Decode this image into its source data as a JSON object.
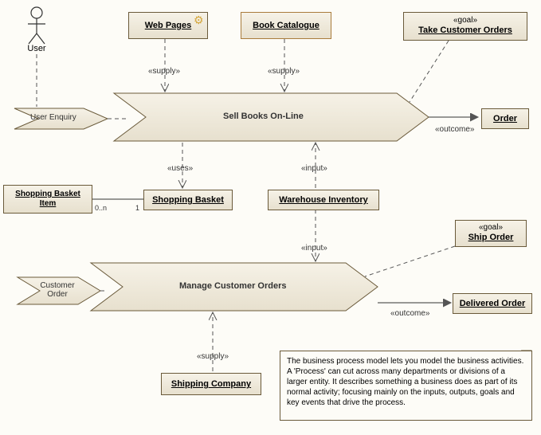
{
  "actor": {
    "label": "User"
  },
  "boxes": {
    "webPages": "Web Pages",
    "bookCatalogue": "Book Catalogue",
    "shoppingBasketItem": "Shopping Basket Item",
    "shoppingBasket": "Shopping Basket",
    "warehouseInventory": "Warehouse Inventory",
    "shippingCompany": "Shipping Company",
    "order": "Order",
    "deliveredOrder": "Delivered Order"
  },
  "goals": {
    "takeCustomerOrders": {
      "stereo": "«goal»",
      "label": "Take Customer Orders"
    },
    "shipOrder": {
      "stereo": "«goal»",
      "label": "Ship Order"
    }
  },
  "processes": {
    "sellBooks": "Sell Books On-Line",
    "manageOrders": "Manage Customer Orders"
  },
  "events": {
    "userEnquiry": "User Enquiry",
    "customerOrder": "Customer Order"
  },
  "labels": {
    "supply": "«supply»",
    "uses": "«uses»",
    "input": "«input»",
    "outcome": "«outcome»"
  },
  "mult": {
    "zeroN": "0..n",
    "one": "1"
  },
  "note": "The business process model lets you model the business activities. A 'Process' can cut across many departments or divisions of a larger entity. It describes something a business does as part of its normal activity; focusing mainly on the inputs, outputs, goals and key events that drive the process."
}
